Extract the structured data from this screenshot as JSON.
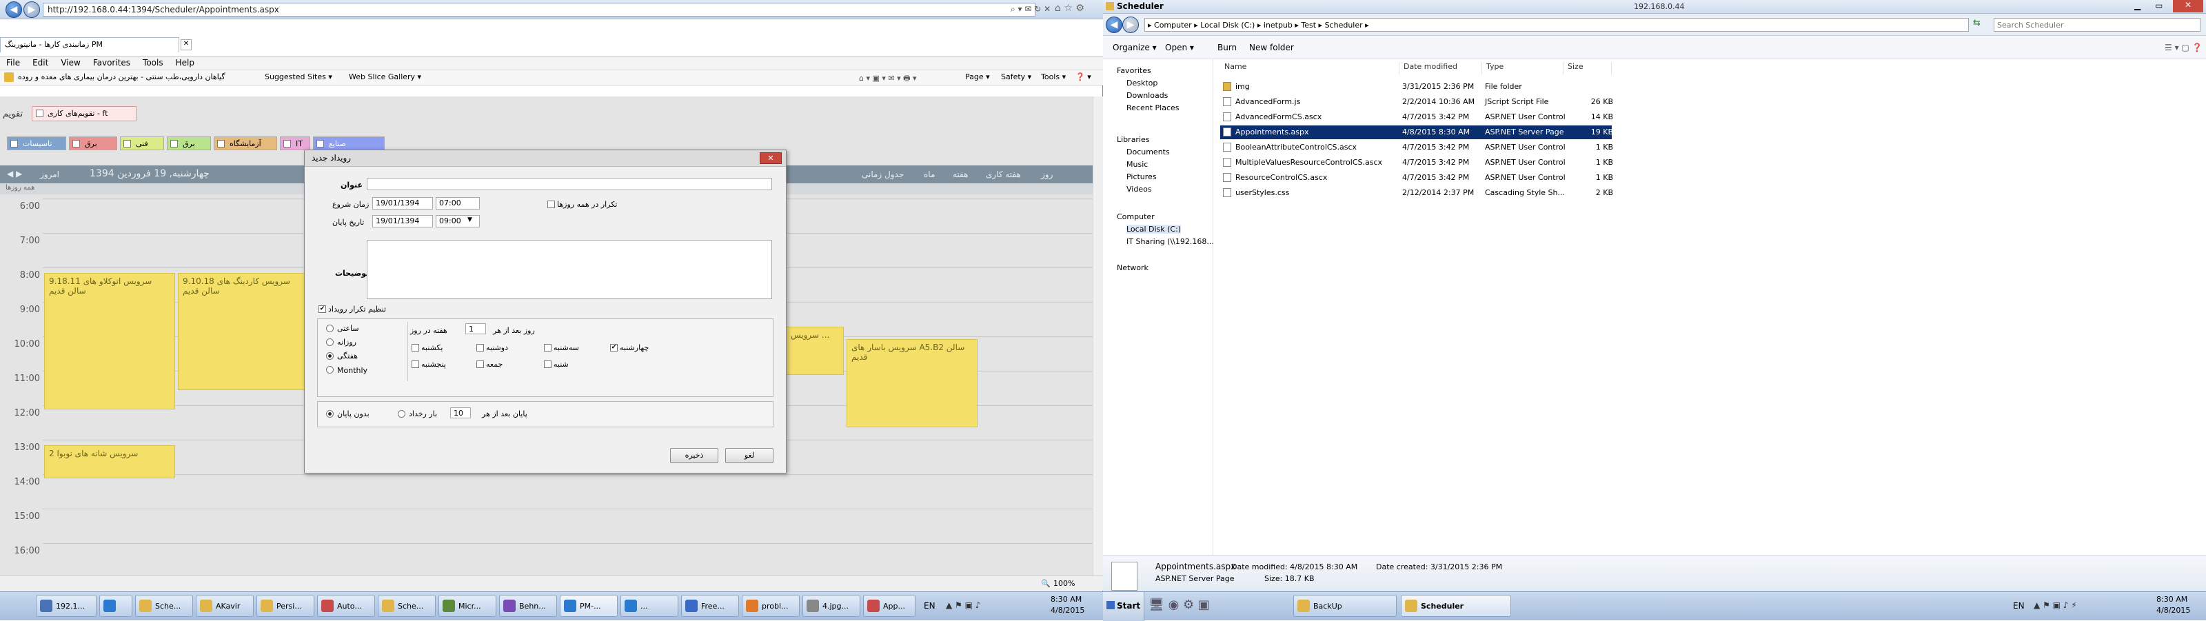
{
  "browser": {
    "title_left": "",
    "url": "http://192.168.0.44:1394/Scheduler/Appointments.aspx",
    "tab_label": "زمانبندی کارها - مانیتورینگ PM",
    "menu": [
      "File",
      "Edit",
      "View",
      "Favorites",
      "Tools",
      "Help"
    ],
    "favorites": [
      "گیاهان دارویی،طب سنتی - بهترین درمان بیماری های معده و روده",
      "Suggested Sites ▾",
      "Web Slice Gallery ▾"
    ],
    "commands": [
      "Page ▾",
      "Safety ▾",
      "Tools ▾",
      "❓ ▾"
    ],
    "zoom": "100%"
  },
  "scheduler": {
    "top_label": "تقویم",
    "top_filter": "تقویم‌های کاری - ft",
    "resource_pills": [
      {
        "label": "تاسیسات",
        "color": "#7fa3cc"
      },
      {
        "label": "برق",
        "color": "#e89292"
      },
      {
        "label": "فنی",
        "color": "#d9ec88"
      },
      {
        "label": "برق",
        "color": "#b9e38c"
      },
      {
        "label": "آزمایشگاه",
        "color": "#e6b97d"
      },
      {
        "label": "IT",
        "color": "#e8a8d8"
      },
      {
        "label": "صنایع",
        "color": "#8e9ef0"
      }
    ],
    "header_left": "امروز",
    "header_date": "چهارشنبه, 19 فروردین 1394",
    "header_views": [
      "روز",
      "هفته کاری",
      "هفته",
      "ماه",
      "جدول زمانی"
    ],
    "subheader": "همه روزها",
    "times": [
      "6:00",
      "7:00",
      "8:00",
      "9:00",
      "10:00",
      "11:00",
      "12:00",
      "13:00",
      "14:00",
      "15:00",
      "16:00"
    ],
    "appointments": [
      {
        "text": "سرویس اتوکلاو های 9.18.11 سالن قدیم"
      },
      {
        "text": "سرویس کاردینگ های 9.10.18 سالن قدیم"
      },
      {
        "text": "سرویس باسار های A5.B2 سالن قدیم"
      },
      {
        "text": "سرویس ..."
      },
      {
        "text": "سرویس شانه های نوبوا 2"
      }
    ]
  },
  "dialog": {
    "title": "رویداد جدید",
    "close": "✕",
    "subject_label": "عنوان",
    "start_label": "زمان شروع",
    "end_label": "تاریخ پایان",
    "start_date": "19/01/1394",
    "start_time": "07:00",
    "end_date": "19/01/1394",
    "end_time": "09:00",
    "all_day_label": "تکرار در همه روزها",
    "description_label": "توضیحات",
    "recurrence_label": "تنظیم تکرار رویداد",
    "freq": [
      "ساعتی",
      "روزانه",
      "هفتگی",
      "Monthly"
    ],
    "every_label": "روز بعد از هر",
    "every_value": "1",
    "every_suffix": "هفته در روز",
    "days": [
      "چهارشنبه",
      "سه‌شنبه",
      "دوشنبه",
      "یکشنبه",
      "شنبه",
      "جمعه",
      "پنجشنبه"
    ],
    "end_after_label": "پایان بعد از هر",
    "end_after_value": "10",
    "end_after_suffix": "بار رخداد",
    "no_end_label": "بدون پایان",
    "save": "ذخیره",
    "cancel": "لغو"
  },
  "explorer": {
    "title": "Scheduler",
    "remote_label": "192.168.0.44",
    "breadcrumb": "▸ Computer ▸ Local Disk (C:) ▸ inetpub ▸ Test ▸ Scheduler ▸",
    "search_placeholder": "Search Scheduler",
    "toolbar": [
      "Organize ▾",
      "Open ▾",
      "Burn",
      "New folder"
    ],
    "nav": {
      "favorites": "Favorites",
      "fav_items": [
        "Desktop",
        "Downloads",
        "Recent Places"
      ],
      "libraries": "Libraries",
      "lib_items": [
        "Documents",
        "Music",
        "Pictures",
        "Videos"
      ],
      "computer": "Computer",
      "comp_items": [
        "Local Disk (C:)",
        "IT Sharing (\\\\192.168..."
      ],
      "network": "Network"
    },
    "columns": [
      "Name",
      "Date modified",
      "Type",
      "Size"
    ],
    "files": [
      {
        "name": "img",
        "date": "3/31/2015 2:36 PM",
        "type": "File folder",
        "size": ""
      },
      {
        "name": "AdvancedForm.js",
        "date": "2/2/2014 10:36 AM",
        "type": "JScript Script File",
        "size": "26 KB"
      },
      {
        "name": "AdvancedFormCS.ascx",
        "date": "4/7/2015 3:42 PM",
        "type": "ASP.NET User Control",
        "size": "14 KB"
      },
      {
        "name": "Appointments.aspx",
        "date": "4/8/2015 8:30 AM",
        "type": "ASP.NET Server Page",
        "size": "19 KB"
      },
      {
        "name": "BooleanAttributeControlCS.ascx",
        "date": "4/7/2015 3:42 PM",
        "type": "ASP.NET User Control",
        "size": "1 KB"
      },
      {
        "name": "MultipleValuesResourceControlCS.ascx",
        "date": "4/7/2015 3:42 PM",
        "type": "ASP.NET User Control",
        "size": "1 KB"
      },
      {
        "name": "ResourceControlCS.ascx",
        "date": "4/7/2015 3:42 PM",
        "type": "ASP.NET User Control",
        "size": "1 KB"
      },
      {
        "name": "userStyles.css",
        "date": "2/12/2014 2:37 PM",
        "type": "Cascading Style Sh...",
        "size": "2 KB"
      }
    ],
    "details": {
      "name": "Appointments.aspx",
      "modified": "Date modified: 4/8/2015 8:30 AM",
      "created": "Date created: 3/31/2015 2:36 PM",
      "type": "ASP.NET Server Page",
      "size": "Size: 18.7 KB"
    }
  },
  "taskbar": {
    "left": [
      {
        "label": "192.1...",
        "color": "#4a73b5"
      },
      {
        "label": "",
        "color": "#2a7ad0"
      },
      {
        "label": "Sche...",
        "color": "#e0b64a"
      },
      {
        "label": "AKavir",
        "color": "#e0b64a"
      },
      {
        "label": "Persi...",
        "color": "#e0b64a"
      },
      {
        "label": "Auto...",
        "color": "#c94a4a"
      },
      {
        "label": "Sche...",
        "color": "#e0b64a"
      },
      {
        "label": "Micr...",
        "color": "#5b8a3a"
      },
      {
        "label": "Behn...",
        "color": "#7a4ab5"
      },
      {
        "label": "PM-...",
        "color": "#2a7ad0"
      },
      {
        "label": "...",
        "color": "#2a7ad0"
      },
      {
        "label": "Free...",
        "color": "#3a6ac5"
      },
      {
        "label": "probl...",
        "color": "#e07a2a"
      },
      {
        "label": "4.jpg...",
        "color": "#888"
      },
      {
        "label": "App...",
        "color": "#c94a4a"
      }
    ],
    "lang_left": "EN",
    "time_left": "8:30 AM",
    "date_left": "4/8/2015",
    "start": "Start",
    "right": [
      {
        "label": "BackUp",
        "color": "#e0b64a"
      },
      {
        "label": "Scheduler",
        "color": "#e0b64a"
      }
    ],
    "lang_right": "EN",
    "time_right": "8:30 AM",
    "date_right": "4/8/2015"
  }
}
